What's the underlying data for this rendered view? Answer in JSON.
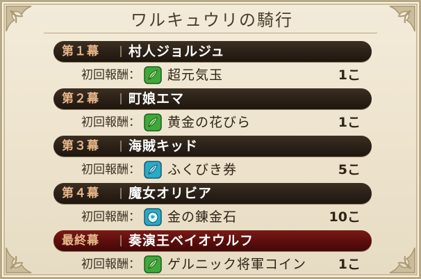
{
  "title": "ワルキュウリの騎行",
  "reward_label": "初回報酬：",
  "chapters": [
    {
      "label": "第１幕",
      "name": "村人ジョルジュ",
      "reward": "超元気玉",
      "qty": "1こ",
      "icon": "leaf-icon",
      "icon_color": "#3fa83a"
    },
    {
      "label": "第２幕",
      "name": "町娘エマ",
      "reward": "黄金の花びら",
      "qty": "1こ",
      "icon": "leaf-icon",
      "icon_color": "#3fa83a"
    },
    {
      "label": "第３幕",
      "name": "海賊キッド",
      "reward": "ふくびき券",
      "qty": "5こ",
      "icon": "leaf-icon",
      "icon_color": "#2aa9c9"
    },
    {
      "label": "第４幕",
      "name": "魔女オリビア",
      "reward": "金の錬金石",
      "qty": "10こ",
      "icon": "ore-icon",
      "icon_color": "#2aa9c9"
    },
    {
      "label": "最終幕",
      "name": "奏演王ベイオウルフ",
      "reward": "ゲルニック将軍コイン",
      "qty": "1こ",
      "icon": "leaf-icon",
      "icon_color": "#3fa83a"
    }
  ],
  "colors": {
    "header_dark": "#2a2017",
    "header_final": "#5a0e0c",
    "chapter_label": "#e8b88a",
    "panel_bg": "#f3ebd9"
  }
}
